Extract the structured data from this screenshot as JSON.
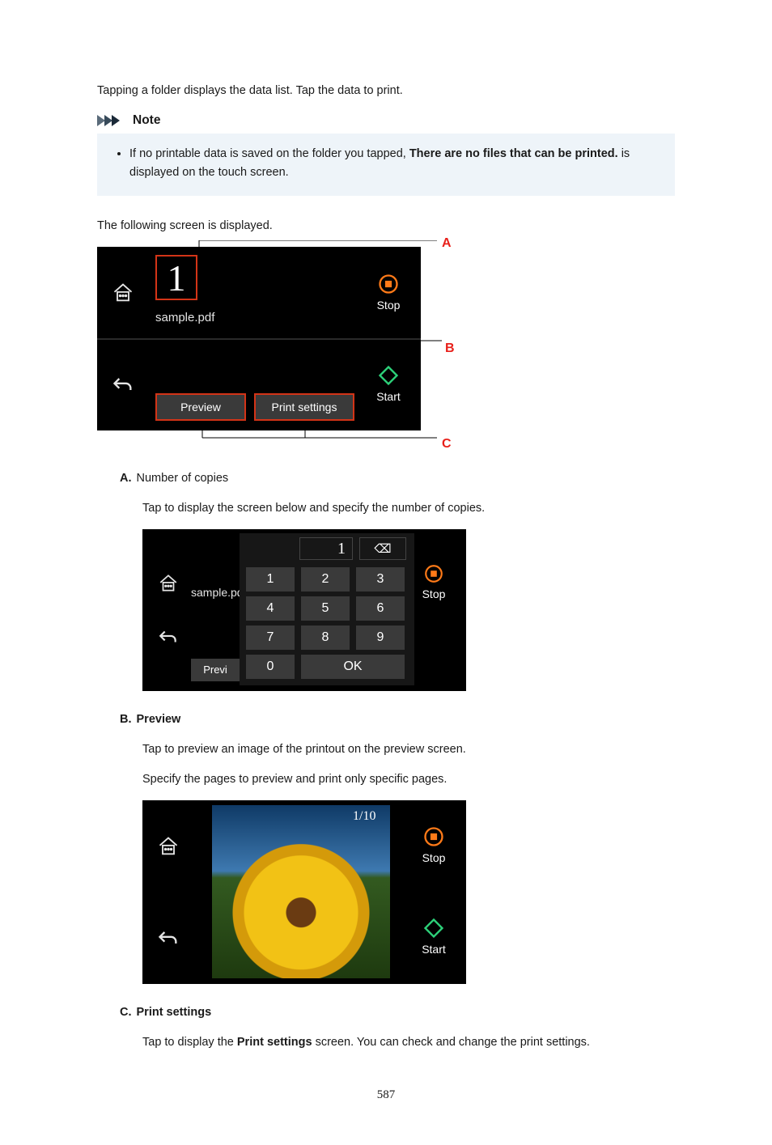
{
  "intro_tap_folder": "Tapping a folder displays the data list. Tap the data to print.",
  "note": {
    "heading": "Note",
    "item_prefix": "If no printable data is saved on the folder you tapped, ",
    "item_bold": "There are no files that can be printed.",
    "item_suffix": " is displayed on the touch screen."
  },
  "following_screen": "The following screen is displayed.",
  "callouts": {
    "A": "A",
    "B": "B",
    "C": "C"
  },
  "shot1": {
    "copies_value": "1",
    "filename": "sample.pdf",
    "preview_btn": "Preview",
    "printsettings_btn": "Print settings",
    "stop": "Stop",
    "start": "Start"
  },
  "item_A": {
    "letter": "A.",
    "title": "Number of copies",
    "desc": "Tap to display the screen below and specify the number of copies."
  },
  "shot2": {
    "filename": "sample.pd",
    "display_value": "1",
    "del_glyph": "⌫",
    "keys": {
      "k1": "1",
      "k2": "2",
      "k3": "3",
      "k4": "4",
      "k5": "5",
      "k6": "6",
      "k7": "7",
      "k8": "8",
      "k9": "9",
      "k0": "0",
      "ok": "OK"
    },
    "prev_btn": "Previ",
    "stop": "Stop"
  },
  "item_B": {
    "letter": "B.",
    "title": "Preview",
    "desc1": "Tap to preview an image of the printout on the preview screen.",
    "desc2": "Specify the pages to preview and print only specific pages."
  },
  "shot3": {
    "page_indicator": "1/10",
    "stop": "Stop",
    "start": "Start"
  },
  "item_C": {
    "letter": "C.",
    "title": "Print settings",
    "desc_prefix": "Tap to display the ",
    "desc_bold": "Print settings",
    "desc_suffix": " screen. You can check and change the print settings."
  },
  "page_number": "587"
}
